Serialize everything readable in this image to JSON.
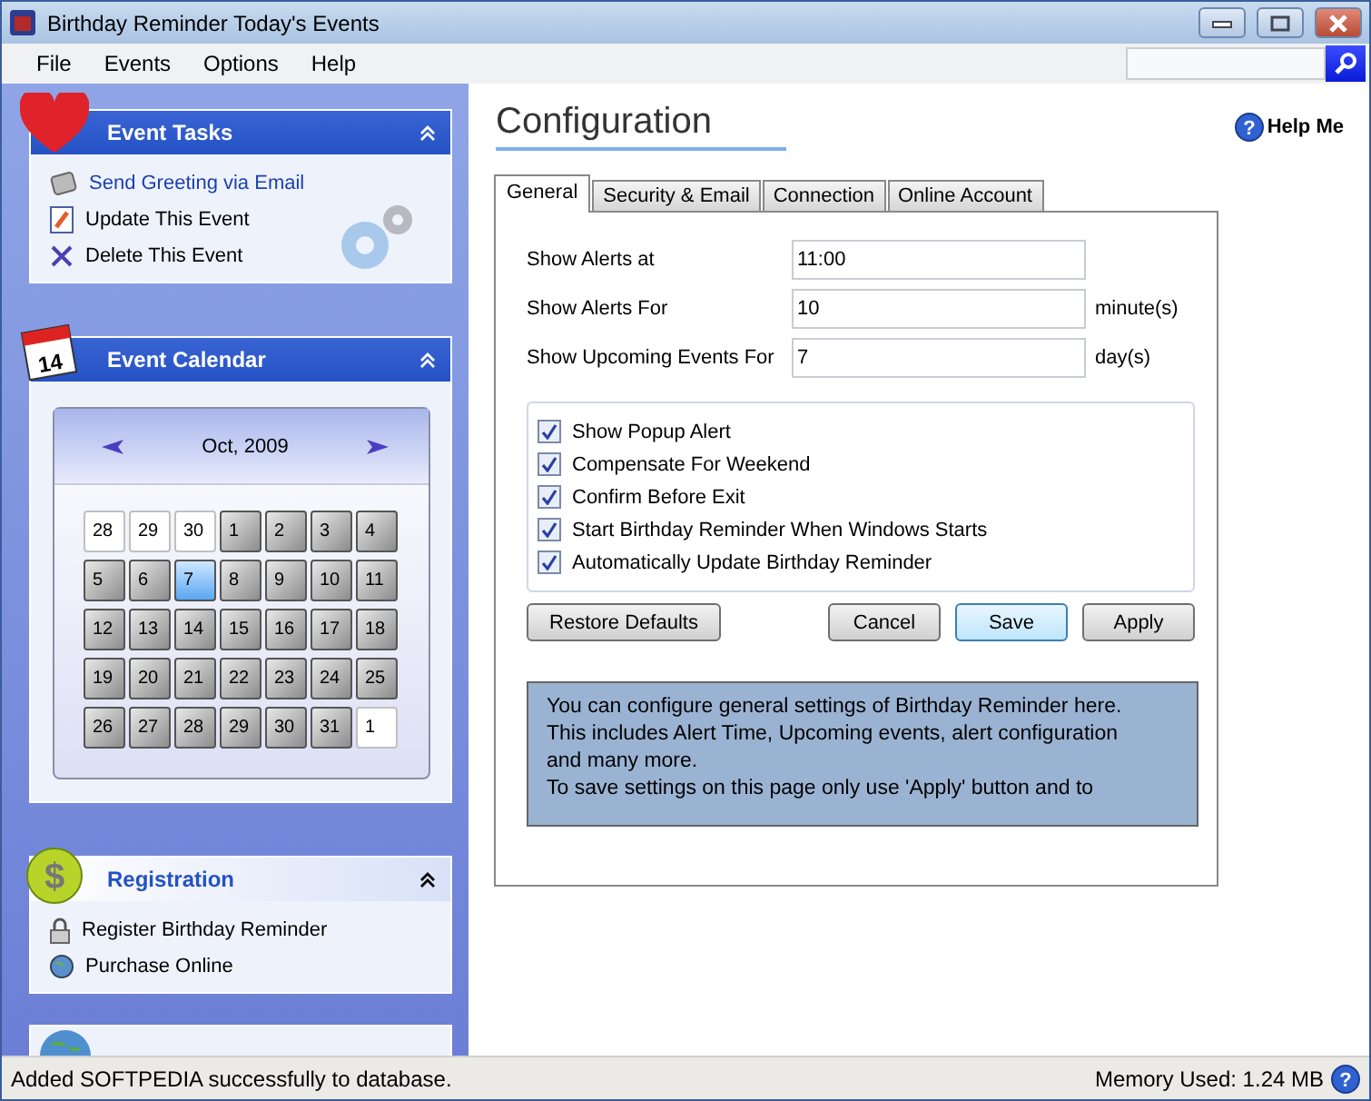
{
  "window": {
    "title": "Birthday Reminder Today's Events"
  },
  "menu": [
    "File",
    "Events",
    "Options",
    "Help"
  ],
  "event_tasks": {
    "title": "Event Tasks",
    "expanded": true,
    "items": [
      {
        "label": "Send Greeting via Email",
        "kind": "email",
        "highlighted": true
      },
      {
        "label": "Update This Event",
        "kind": "edit",
        "highlighted": false
      },
      {
        "label": "Delete This Event",
        "kind": "delete",
        "highlighted": false
      }
    ]
  },
  "event_calendar": {
    "title": "Event Calendar",
    "icon_text": "14",
    "expanded": true,
    "month": "Oct, 2009",
    "days": [
      {
        "label": "28",
        "in_month": false,
        "selected": false
      },
      {
        "label": "29",
        "in_month": false,
        "selected": false
      },
      {
        "label": "30",
        "in_month": false,
        "selected": false
      },
      {
        "label": "1",
        "in_month": true,
        "selected": false
      },
      {
        "label": "2",
        "in_month": true,
        "selected": false
      },
      {
        "label": "3",
        "in_month": true,
        "selected": false
      },
      {
        "label": "4",
        "in_month": true,
        "selected": false
      },
      {
        "label": "5",
        "in_month": true,
        "selected": false
      },
      {
        "label": "6",
        "in_month": true,
        "selected": false
      },
      {
        "label": "7",
        "in_month": true,
        "selected": true
      },
      {
        "label": "8",
        "in_month": true,
        "selected": false
      },
      {
        "label": "9",
        "in_month": true,
        "selected": false
      },
      {
        "label": "10",
        "in_month": true,
        "selected": false
      },
      {
        "label": "11",
        "in_month": true,
        "selected": false
      },
      {
        "label": "12",
        "in_month": true,
        "selected": false
      },
      {
        "label": "13",
        "in_month": true,
        "selected": false
      },
      {
        "label": "14",
        "in_month": true,
        "selected": false
      },
      {
        "label": "15",
        "in_month": true,
        "selected": false
      },
      {
        "label": "16",
        "in_month": true,
        "selected": false
      },
      {
        "label": "17",
        "in_month": true,
        "selected": false
      },
      {
        "label": "18",
        "in_month": true,
        "selected": false
      },
      {
        "label": "19",
        "in_month": true,
        "selected": false
      },
      {
        "label": "20",
        "in_month": true,
        "selected": false
      },
      {
        "label": "21",
        "in_month": true,
        "selected": false
      },
      {
        "label": "22",
        "in_month": true,
        "selected": false
      },
      {
        "label": "23",
        "in_month": true,
        "selected": false
      },
      {
        "label": "24",
        "in_month": true,
        "selected": false
      },
      {
        "label": "25",
        "in_month": true,
        "selected": false
      },
      {
        "label": "26",
        "in_month": true,
        "selected": false
      },
      {
        "label": "27",
        "in_month": true,
        "selected": false
      },
      {
        "label": "28",
        "in_month": true,
        "selected": false
      },
      {
        "label": "29",
        "in_month": true,
        "selected": false
      },
      {
        "label": "30",
        "in_month": true,
        "selected": false
      },
      {
        "label": "31",
        "in_month": true,
        "selected": false
      },
      {
        "label": "1",
        "in_month": false,
        "selected": false
      }
    ]
  },
  "registration": {
    "title": "Registration",
    "icon_text": "$",
    "expanded": true,
    "items": [
      {
        "label": "Register Birthday Reminder",
        "kind": "lock"
      },
      {
        "label": "Purchase Online",
        "kind": "globe"
      }
    ]
  },
  "configuration": {
    "title": "Configuration",
    "help_icon": "?",
    "help": "Help Me",
    "tabs": [
      {
        "label": "General",
        "selected": true
      },
      {
        "label": "Security & Email",
        "selected": false
      },
      {
        "label": "Connection",
        "selected": false
      },
      {
        "label": "Online Account",
        "selected": false
      }
    ],
    "fields": [
      {
        "label": "Show Alerts at",
        "value": "11:00"
      },
      {
        "label": "Show Alerts For",
        "value": "10",
        "unit": "minute(s)"
      },
      {
        "label": "Show Upcoming Events For",
        "value": "7",
        "unit": "day(s)"
      }
    ],
    "options": [
      {
        "label": "Show Popup Alert",
        "checked": true
      },
      {
        "label": "Compensate For Weekend",
        "checked": true
      },
      {
        "label": "Confirm Before Exit",
        "checked": true
      },
      {
        "label": "Start Birthday Reminder When Windows Starts",
        "checked": true
      },
      {
        "label": "Automatically Update Birthday Reminder",
        "checked": true
      }
    ],
    "buttons": [
      {
        "label": "Restore Defaults",
        "focused": false
      },
      {
        "label": "Cancel",
        "focused": false
      },
      {
        "label": "Save",
        "focused": true
      },
      {
        "label": "Apply",
        "focused": false
      }
    ],
    "info": [
      "You can configure general settings of Birthday Reminder here.",
      "This includes Alert Time, Upcoming events, alert configuration",
      "and many more.",
      "To save settings on this page only use 'Apply' button and to"
    ]
  },
  "status_bar": {
    "message": "Added SOFTPEDIA successfully to database.",
    "memory": "Memory Used: 1.24 MB",
    "help_icon": "?"
  }
}
